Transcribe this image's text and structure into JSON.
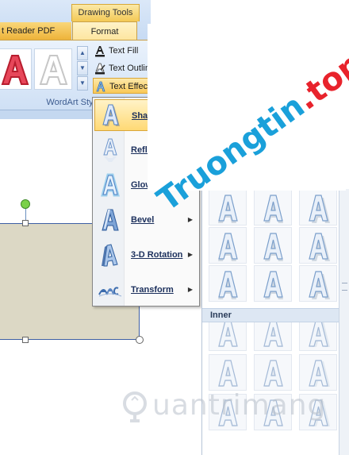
{
  "ribbon": {
    "contextual_group": "Drawing Tools",
    "tabs": [
      {
        "label": "t Reader PDF"
      },
      {
        "label": "Format"
      }
    ],
    "gallery": {
      "styles": [
        {
          "icon": "wordart-red-fill-style"
        },
        {
          "icon": "wordart-white-outline-style"
        }
      ]
    },
    "commands": [
      {
        "label": "Text Fill",
        "icon": "text-fill-icon"
      },
      {
        "label": "Text Outline",
        "icon": "text-outline-icon"
      },
      {
        "label": "Text Effects",
        "icon": "text-effects-icon"
      }
    ],
    "group_label": "WordArt Styles"
  },
  "effects_menu": {
    "items": [
      {
        "label": "Shadow",
        "icon": "shadow-effect-icon",
        "submenu": true,
        "highlighted": true
      },
      {
        "label": "Reflection",
        "icon": "reflection-effect-icon",
        "submenu": true
      },
      {
        "label": "Glow",
        "icon": "glow-effect-icon",
        "submenu": true
      },
      {
        "label": "Bevel",
        "icon": "bevel-effect-icon",
        "submenu": true
      },
      {
        "label": "3-D Rotation",
        "icon": "3d-rotation-effect-icon",
        "submenu": true
      },
      {
        "label": "Transform",
        "icon": "transform-effect-icon",
        "submenu": true
      }
    ]
  },
  "submenu": {
    "section_inner": "Inner"
  },
  "watermark": {
    "main": "Truongtin",
    "tld": ".top",
    "bottom": "uantrimang"
  },
  "colors": {
    "ribbon_blue": "#c6daf3",
    "highlight_gold": "#ffd975",
    "shape_fill": "#dcd8c5",
    "shape_border": "#3e5fa4",
    "watermark_blue": "#1aa0da",
    "watermark_red": "#e8232c"
  }
}
